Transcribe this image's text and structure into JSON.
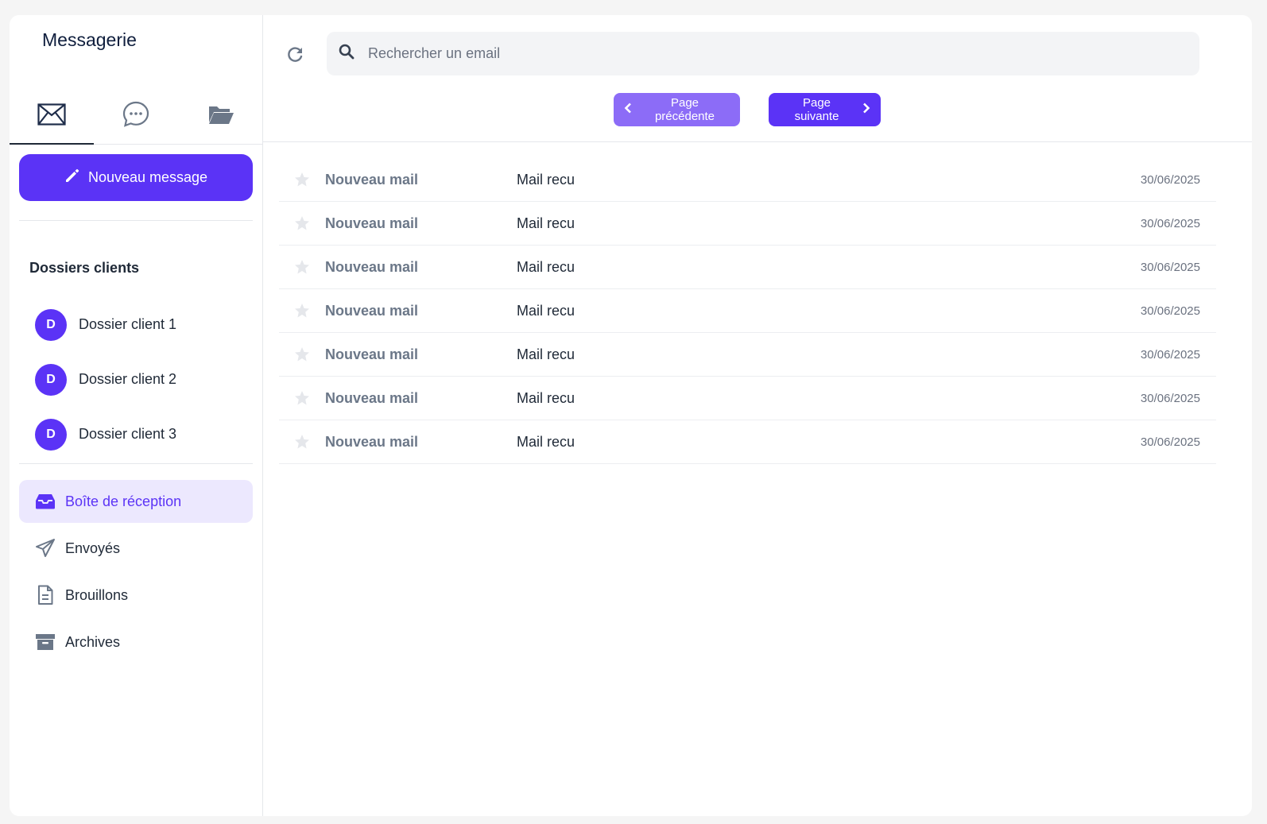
{
  "app": {
    "title": "Messagerie"
  },
  "top_tabs": [
    {
      "name": "mail-icon",
      "active": true
    },
    {
      "name": "chat-icon",
      "active": false
    },
    {
      "name": "folder-open-icon",
      "active": false
    }
  ],
  "new_message": {
    "label": "Nouveau message",
    "icon": "pencil-icon"
  },
  "clients": {
    "heading": "Dossiers clients",
    "items": [
      {
        "initial": "D",
        "label": "Dossier client 1"
      },
      {
        "initial": "D",
        "label": "Dossier client 2"
      },
      {
        "initial": "D",
        "label": "Dossier client 3"
      }
    ]
  },
  "folders": [
    {
      "label": "Boîte de réception",
      "icon": "inbox-icon",
      "active": true
    },
    {
      "label": "Envoyés",
      "icon": "paper-plane-icon",
      "active": false
    },
    {
      "label": "Brouillons",
      "icon": "document-icon",
      "active": false
    },
    {
      "label": "Archives",
      "icon": "archive-icon",
      "active": false
    }
  ],
  "search": {
    "placeholder": "Rechercher un email",
    "value": ""
  },
  "pager": {
    "prev_label": "Page précédente",
    "next_label": "Page suivante"
  },
  "mails": [
    {
      "sender": "Nouveau mail",
      "subject": "Mail recu",
      "date": "30/06/2025",
      "starred": false
    },
    {
      "sender": "Nouveau mail",
      "subject": "Mail recu",
      "date": "30/06/2025",
      "starred": false
    },
    {
      "sender": "Nouveau mail",
      "subject": "Mail recu",
      "date": "30/06/2025",
      "starred": false
    },
    {
      "sender": "Nouveau mail",
      "subject": "Mail recu",
      "date": "30/06/2025",
      "starred": false
    },
    {
      "sender": "Nouveau mail",
      "subject": "Mail recu",
      "date": "30/06/2025",
      "starred": false
    },
    {
      "sender": "Nouveau mail",
      "subject": "Mail recu",
      "date": "30/06/2025",
      "starred": false
    },
    {
      "sender": "Nouveau mail",
      "subject": "Mail recu",
      "date": "30/06/2025",
      "starred": false
    }
  ],
  "colors": {
    "accent": "#5b33f6",
    "accent_light": "#8c6cf7",
    "active_bg": "#ece8fe",
    "muted": "#6b7788"
  }
}
